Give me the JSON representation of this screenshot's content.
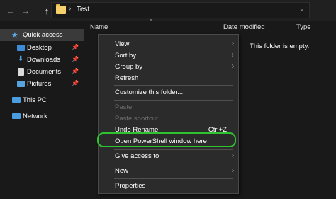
{
  "window": {
    "path": "Test"
  },
  "nav": {
    "back_icon": "arrow-left-icon",
    "forward_icon": "arrow-right-icon",
    "up_icon": "arrow-up-icon",
    "back_glyph": "←",
    "forward_glyph": "→",
    "up_glyph": "↑",
    "breadcrumb_chevron": "›",
    "dropdown_glyph": "⌄"
  },
  "sidebar": {
    "items": [
      {
        "label": "Quick access",
        "icon": "star-icon",
        "pinned": false,
        "selected": true
      },
      {
        "label": "Desktop",
        "icon": "desktop-folder-icon",
        "pinned": true
      },
      {
        "label": "Downloads",
        "icon": "download-icon",
        "pinned": true
      },
      {
        "label": "Documents",
        "icon": "documents-icon",
        "pinned": true
      },
      {
        "label": "Pictures",
        "icon": "pictures-icon",
        "pinned": true
      },
      {
        "label": "This PC",
        "icon": "computer-icon",
        "pinned": false
      },
      {
        "label": "Network",
        "icon": "network-icon",
        "pinned": false
      }
    ],
    "pin_glyph": "📌"
  },
  "columns": {
    "name": "Name",
    "date_modified": "Date modified",
    "type": "Type"
  },
  "content": {
    "empty_message": "This folder is empty."
  },
  "context_menu": {
    "items": [
      {
        "label": "View",
        "submenu": true
      },
      {
        "label": "Sort by",
        "submenu": true
      },
      {
        "label": "Group by",
        "submenu": true
      },
      {
        "label": "Refresh"
      },
      {
        "label": "Customize this folder..."
      },
      {
        "label": "Paste",
        "disabled": true
      },
      {
        "label": "Paste shortcut",
        "disabled": true
      },
      {
        "label": "Undo Rename",
        "shortcut": "Ctrl+Z"
      },
      {
        "label": "Open PowerShell window here",
        "highlighted": true
      },
      {
        "label": "Give access to",
        "submenu": true
      },
      {
        "label": "New",
        "submenu": true
      },
      {
        "label": "Properties"
      }
    ],
    "arrow_glyph": "›",
    "highlight_color": "#2fc42f"
  },
  "colors": {
    "background": "#191919",
    "menu_bg": "#2b2b2b",
    "accent_blue": "#5aa7e6",
    "folder_yellow": "#f5d06b"
  }
}
